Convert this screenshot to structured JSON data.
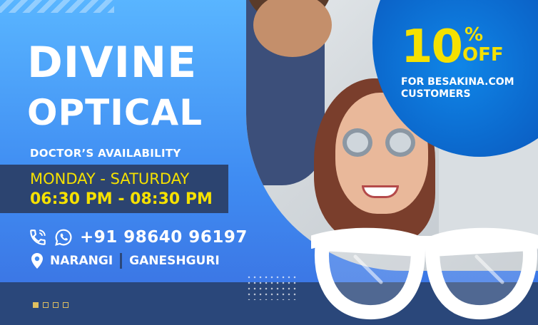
{
  "brand": {
    "title_line1": "DIVINE",
    "title_line2": "OPTICAL"
  },
  "availability": {
    "heading": "DOCTOR’S AVAILABILITY",
    "days": "MONDAY - SATURDAY",
    "hours": "06:30 PM - 08:30 PM"
  },
  "contact": {
    "phone": "+91 98640 96197",
    "location_1": "NARANGI",
    "location_2": "GANESHGURI"
  },
  "offer": {
    "percent": "10",
    "percent_symbol": "%",
    "off": "OFF",
    "line1": "FOR BESAKINA.COM",
    "line2": "CUSTOMERS"
  },
  "colors": {
    "background_top": "#59b5ff",
    "background_bottom": "#3b6fe0",
    "accent_yellow": "#f5e100",
    "dark_navy": "#2a477a",
    "offer_blue": "#0b5fc4"
  },
  "icons": [
    "phone-icon",
    "whatsapp-icon",
    "location-pin-icon",
    "eyeglasses-icon"
  ],
  "pager": {
    "count": 4,
    "active_index": 0
  }
}
